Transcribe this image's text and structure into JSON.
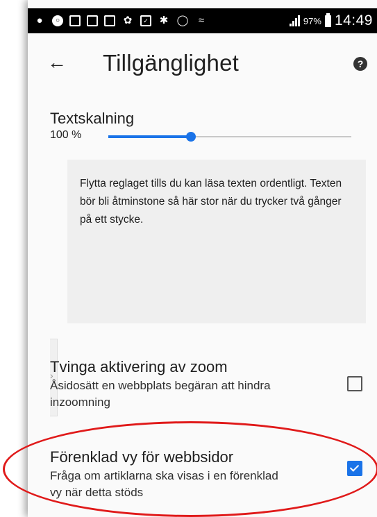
{
  "status_bar": {
    "icons": [
      "chat-icon",
      "circle-icon",
      "gallery-icon",
      "screenshot-icon",
      "image-icon",
      "bird-icon",
      "checkbox-icon",
      "bluetooth-icon",
      "alarm-icon",
      "wifi-icon",
      "signal-icon"
    ],
    "battery_percent": "97%",
    "time": "14:49"
  },
  "toolbar": {
    "back_icon": "arrow-left-icon",
    "title": "Tillgänglighet",
    "help_icon": "help-icon"
  },
  "text_scaling": {
    "label": "Textskalning",
    "value": "100 %",
    "slider_fraction": 0.34,
    "accent_color": "#1a73e8"
  },
  "preview": {
    "text": "Flytta reglaget tills du kan läsa texten ordentligt. Texten bör bli åtminstone så här stor när du trycker två gånger på ett stycke."
  },
  "settings": [
    {
      "title": "Tvinga aktivering av zoom",
      "description": "Åsidosätt en webbplats begäran att hindra inzoomning",
      "checked": false
    },
    {
      "title": "Förenklad vy för webbsidor",
      "description": "Fråga om artiklarna ska visas i en förenklad vy när detta stöds",
      "checked": true
    }
  ],
  "annotation_color": "#e01a1a"
}
